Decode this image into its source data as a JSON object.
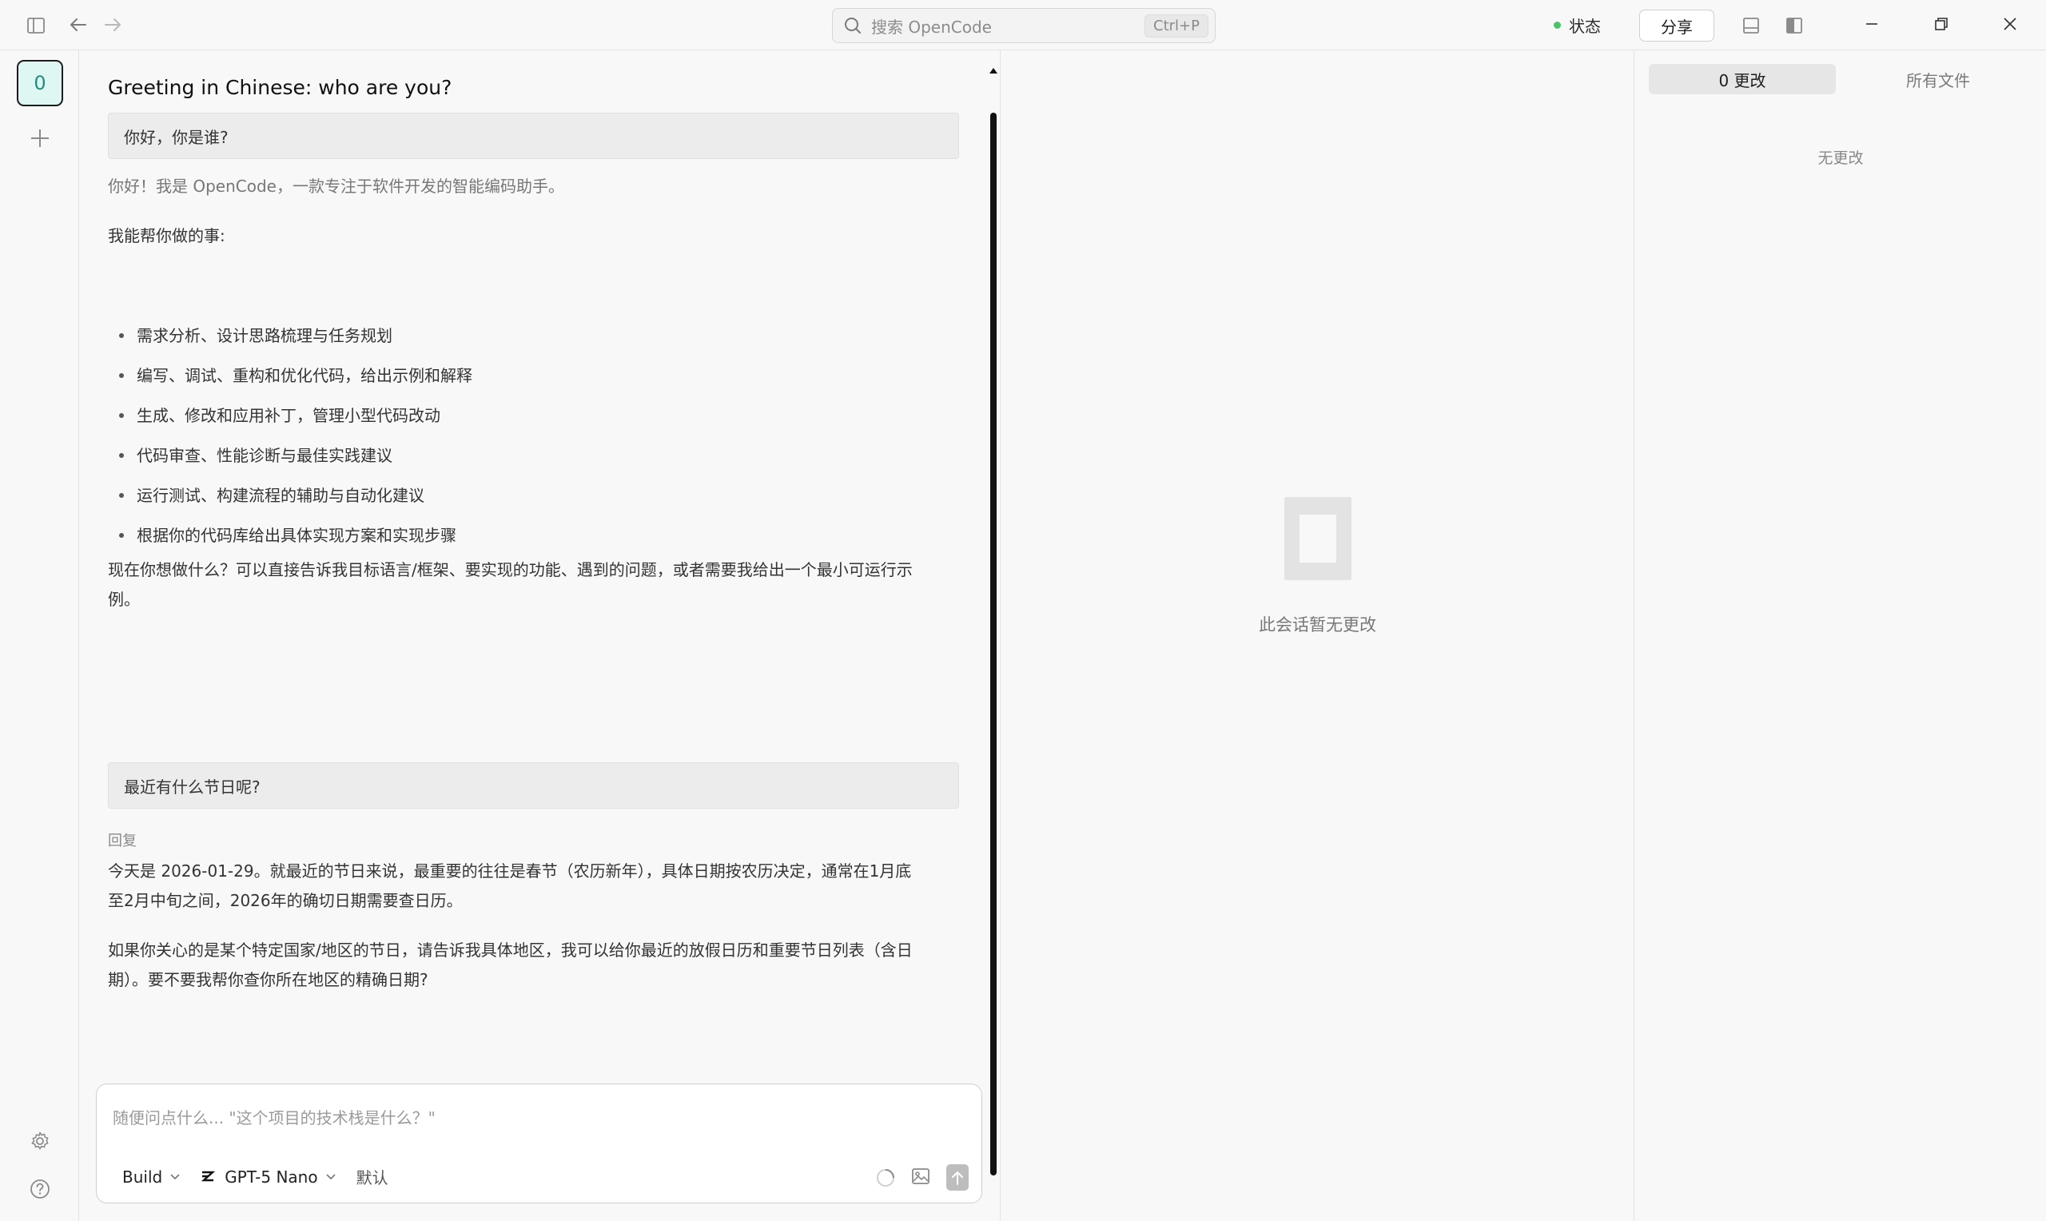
{
  "titlebar": {
    "search_placeholder": "搜索 OpenCode",
    "search_shortcut": "Ctrl+P",
    "status_label": "状态",
    "share_label": "分享"
  },
  "sidebar": {
    "session_badge": "0"
  },
  "chat": {
    "title": "Greeting in Chinese: who are you?",
    "messages": [
      {
        "user": "你好，你是谁?",
        "intro": "你好！我是 OpenCode，一款专注于软件开发的智能编码助手。",
        "lead": "我能帮你做的事:",
        "bullets": [
          "需求分析、设计思路梳理与任务规划",
          "编写、调试、重构和优化代码，给出示例和解释",
          "生成、修改和应用补丁，管理小型代码改动",
          "代码审查、性能诊断与最佳实践建议",
          "运行测试、构建流程的辅助与自动化建议",
          "根据你的代码库给出具体实现方案和实现步骤"
        ],
        "closing_line1": "现在你想做什么？可以直接告诉我目标语言/框架、要实现的功能、遇到的问题，或者需要我给出一个最小可运行示",
        "closing_line2": "例。"
      },
      {
        "user": "最近有什么节日呢?",
        "reply_label": "回复",
        "para1_line1": "今天是 2026-01-29。就最近的节日来说，最重要的往往是春节（农历新年），具体日期按农历决定，通常在1月底",
        "para1_line2": "至2月中旬之间，2026年的确切日期需要查日历。",
        "para2_line1": "如果你关心的是某个特定国家/地区的节日，请告诉我具体地区，我可以给你最近的放假日历和重要节日列表（含日",
        "para2_line2": "期）。要不要我帮你查你所在地区的精确日期?"
      }
    ]
  },
  "composer": {
    "placeholder": "随便问点什么... \"这个项目的技术栈是什么？\"",
    "agent": "Build",
    "model": "GPT-5 Nano",
    "variant": "默认"
  },
  "review": {
    "empty_text": "此会话暂无更改"
  },
  "changes_panel": {
    "tab_changes": "0 更改",
    "tab_all_files": "所有文件",
    "empty": "无更改"
  },
  "colors": {
    "accent_badge_bg": "#dff7f2",
    "accent_badge_text": "#1f8f80",
    "status_dot": "#4cc26a"
  }
}
